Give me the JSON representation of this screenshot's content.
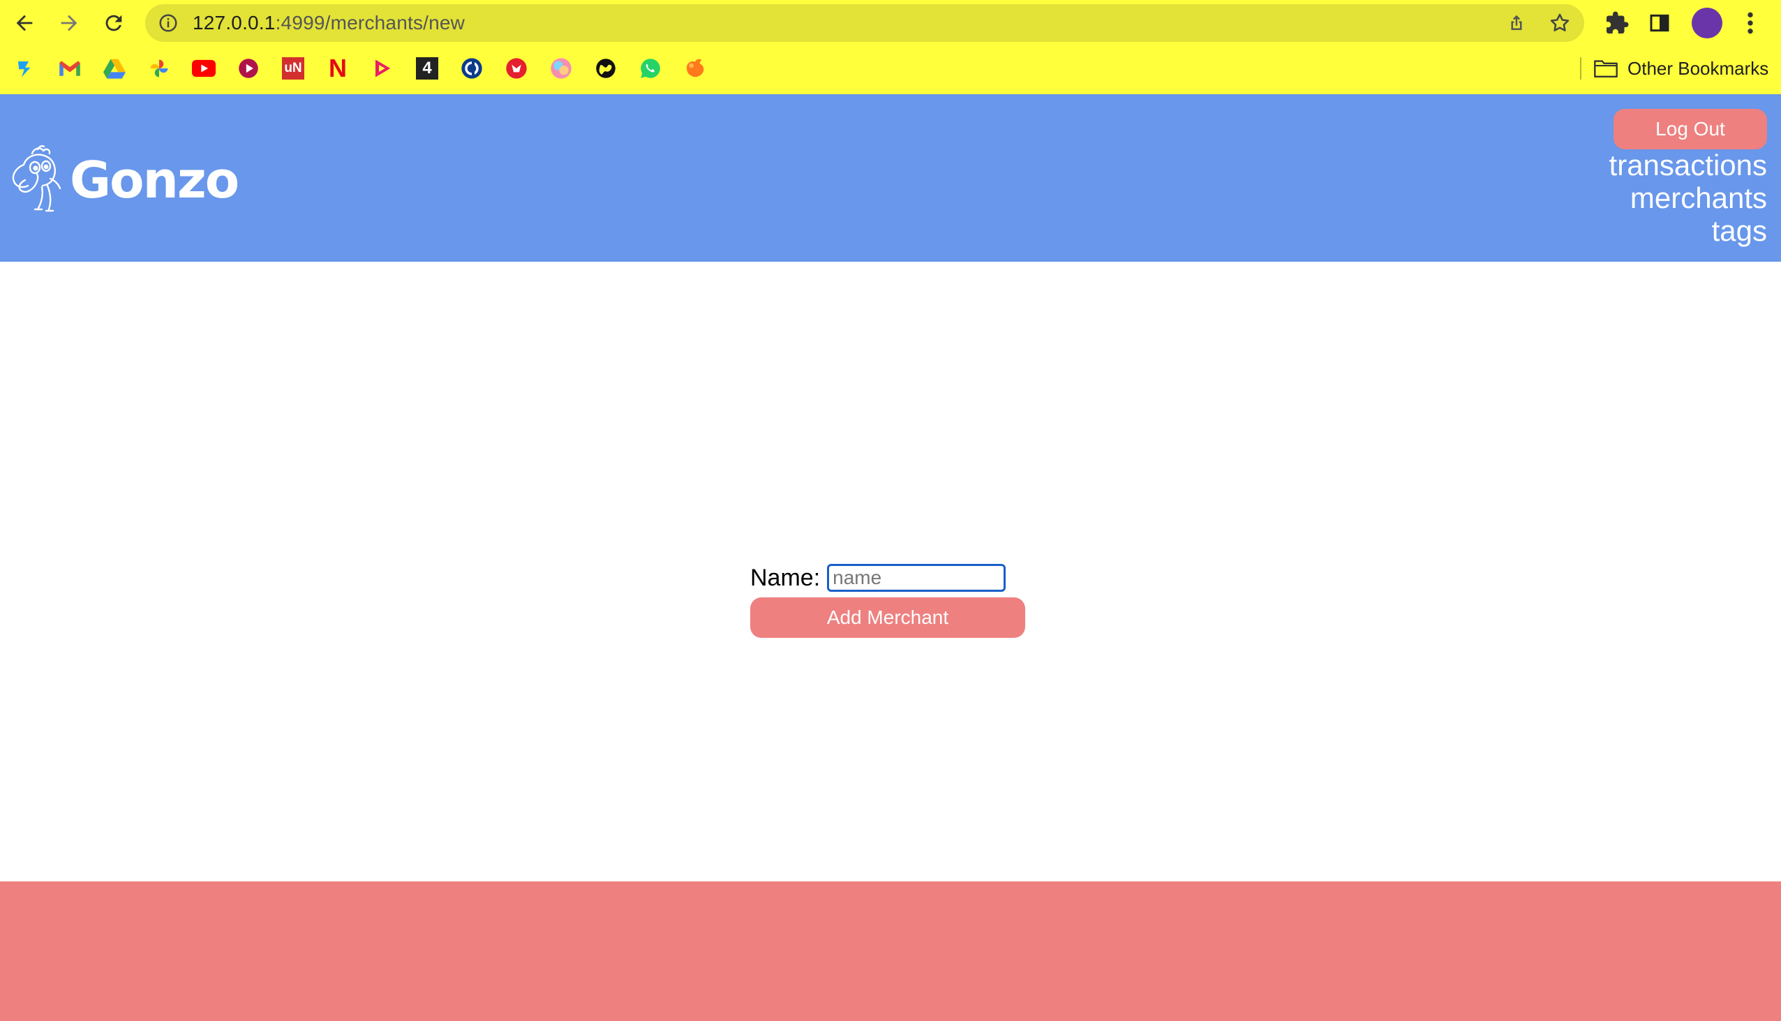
{
  "browser": {
    "url_host": "127.0.0.1",
    "url_path": ":4999/merchants/new",
    "other_bookmarks_label": "Other Bookmarks",
    "bookmarks": [
      {
        "icon": "lightning-app-icon",
        "color": "#1da1f2"
      },
      {
        "icon": "gmail-icon",
        "color": "#ea4335"
      },
      {
        "icon": "google-drive-icon",
        "color": "#fbbc04"
      },
      {
        "icon": "google-photos-icon",
        "color": "#34a853"
      },
      {
        "icon": "youtube-icon",
        "color": "#ff0000"
      },
      {
        "icon": "play-circle-icon",
        "color": "#c2185b"
      },
      {
        "icon": "un-logo-icon",
        "text": "uN",
        "color": "#d32f2f"
      },
      {
        "icon": "netflix-icon",
        "text": "N",
        "color": "#e50914"
      },
      {
        "icon": "play-triangle-icon",
        "color": "#e91e63"
      },
      {
        "icon": "channel4-icon",
        "text": "4",
        "color": "#222222"
      },
      {
        "icon": "g-circle-icon",
        "color": "#0d3b8c"
      },
      {
        "icon": "red-circle-icon",
        "color": "#e5202e"
      },
      {
        "icon": "colorful-circle-icon",
        "color": "#f48fb1"
      },
      {
        "icon": "globe-icon",
        "color": "#111111"
      },
      {
        "icon": "whatsapp-icon",
        "color": "#25d366"
      },
      {
        "icon": "orange-logo-icon",
        "color": "#ff7a1a"
      }
    ]
  },
  "header": {
    "logo_text": "Gonzo",
    "logout_label": "Log Out",
    "nav": [
      "transactions",
      "merchants",
      "tags"
    ]
  },
  "form": {
    "name_label": "Name:",
    "name_placeholder": "name",
    "submit_label": "Add Merchant"
  },
  "colors": {
    "chrome": "#ffff3c",
    "header": "#6897eb",
    "accent": "#ee8080",
    "focus": "#1a5fc8"
  }
}
